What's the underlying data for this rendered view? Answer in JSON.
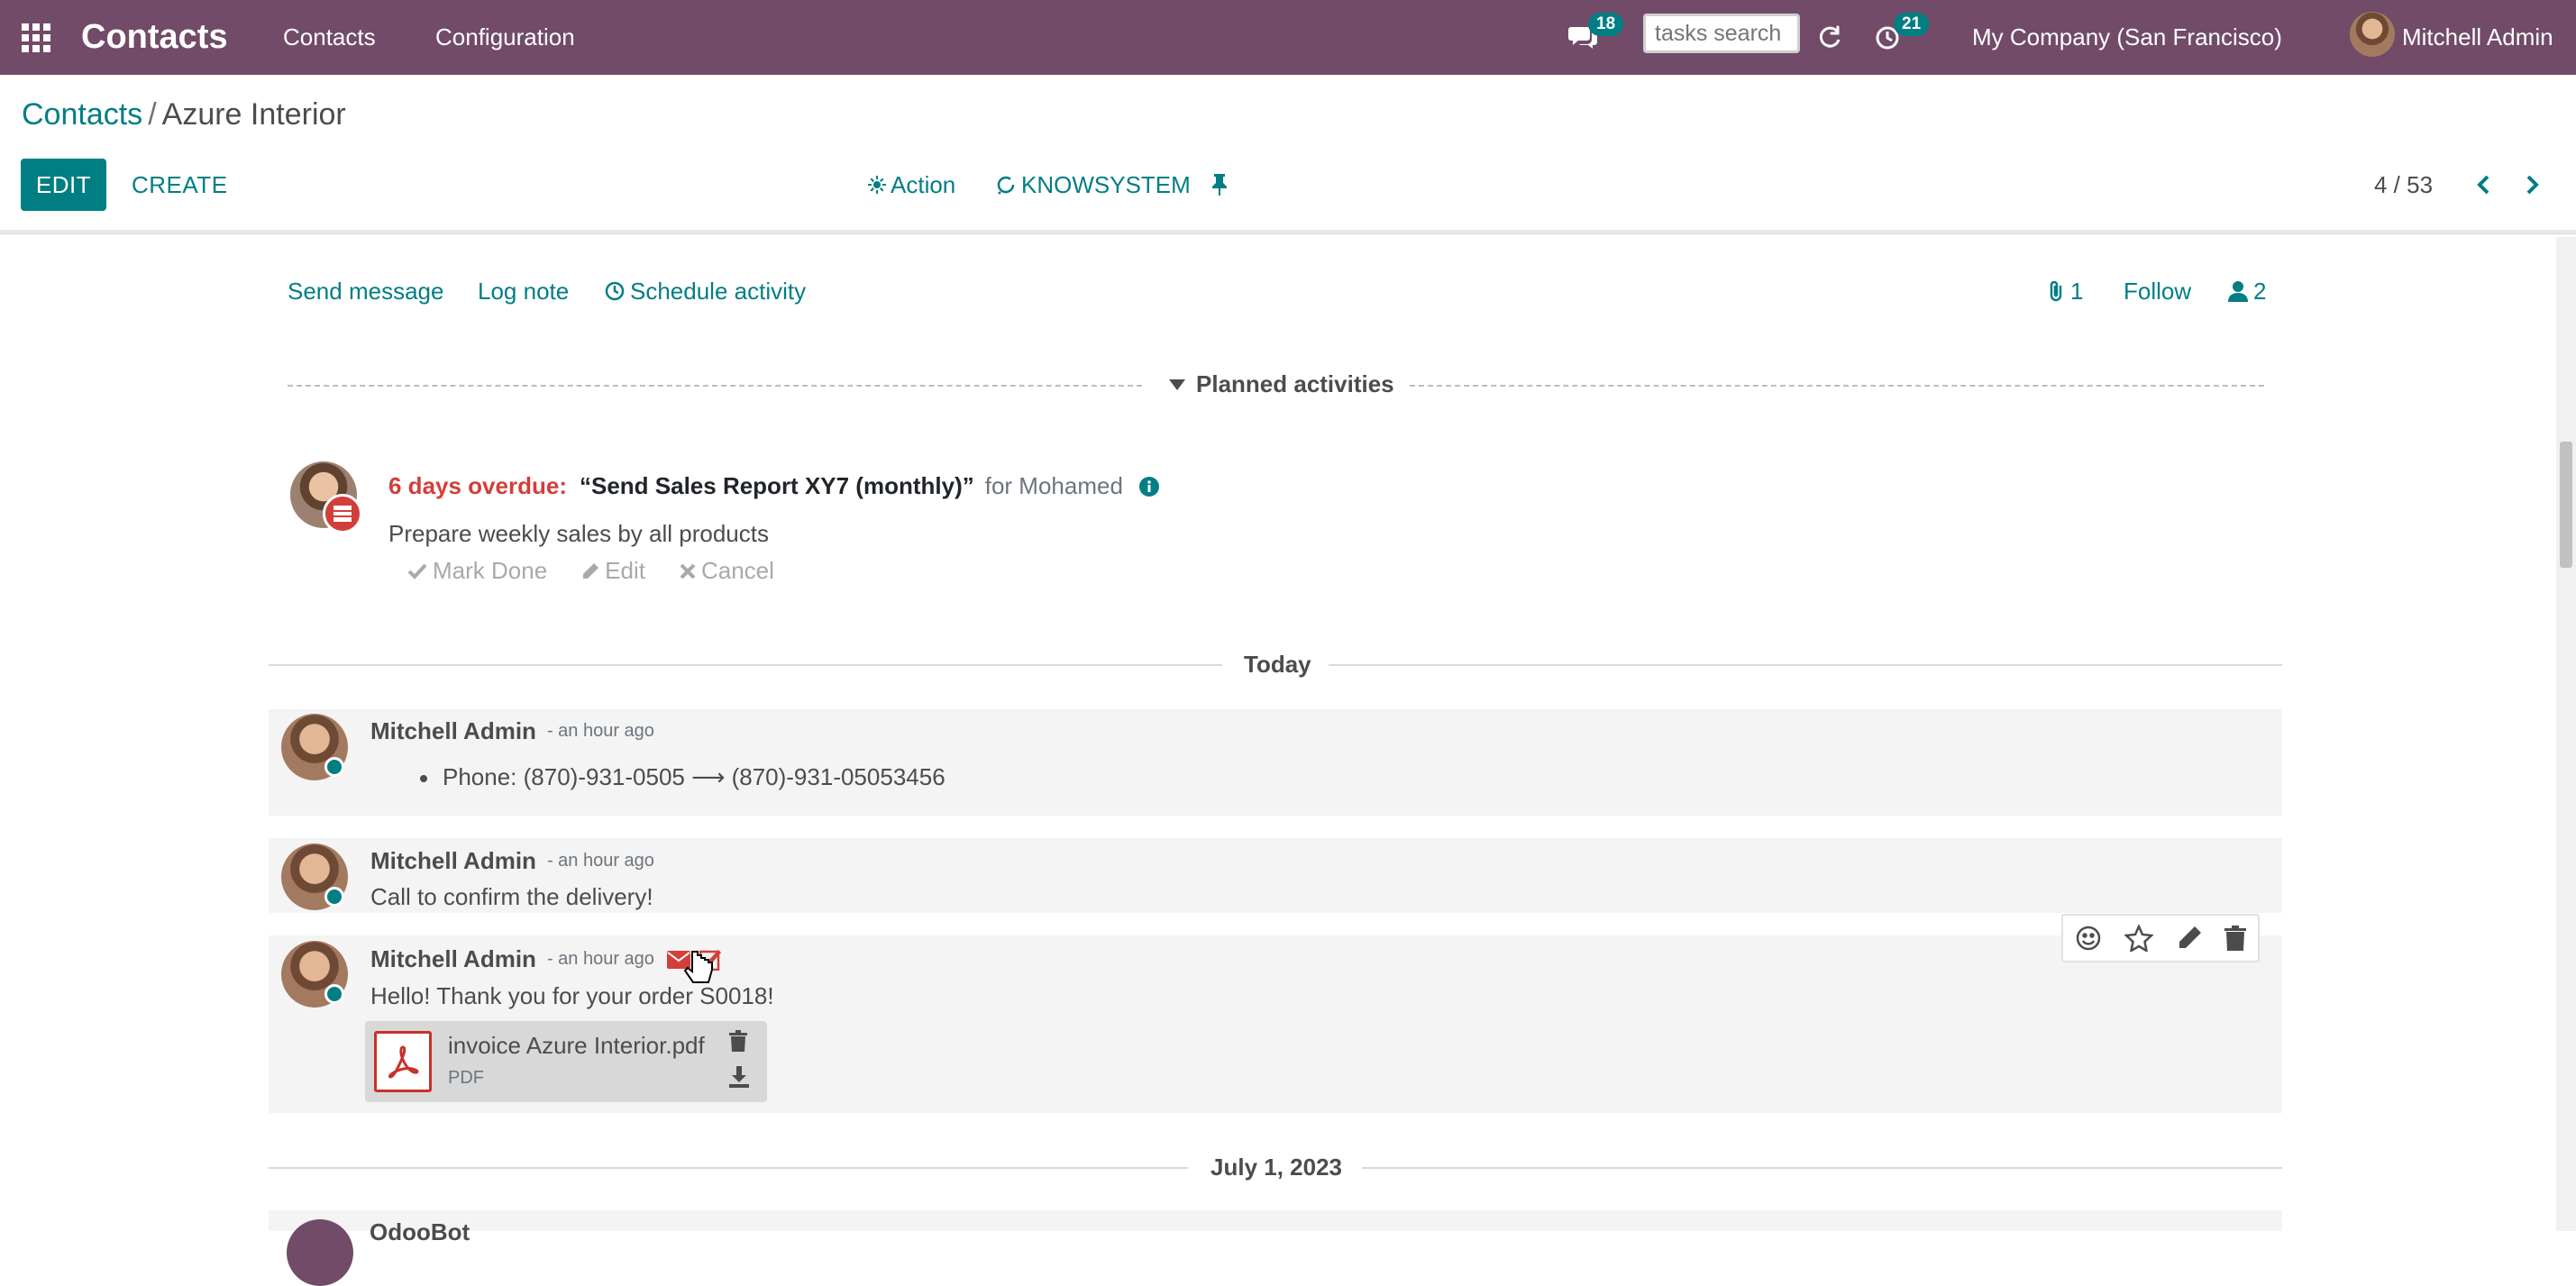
{
  "navbar": {
    "brand": "Contacts",
    "menu": [
      "Contacts",
      "Configuration"
    ],
    "messages_count": "18",
    "search_placeholder": "tasks search",
    "activities_count": "21",
    "company": "My Company (San Francisco)",
    "user": "Mitchell Admin"
  },
  "control_panel": {
    "breadcrumb_root": "Contacts",
    "breadcrumb_separator": "/",
    "breadcrumb_current": "Azure Interior",
    "edit_label": "EDIT",
    "create_label": "CREATE",
    "action_label": "Action",
    "knowsystem_label": "KNOWSYSTEM",
    "pager": "4 / 53"
  },
  "chatter": {
    "send_message": "Send message",
    "log_note": "Log note",
    "schedule_activity": "Schedule activity",
    "attachments_count": "1",
    "follow": "Follow",
    "followers_count": "2"
  },
  "planned_activities": {
    "label": "Planned activities",
    "activity": {
      "overdue": "6 days overdue:",
      "title": "“Send Sales Report XY7 (monthly)”",
      "for": "for Mohamed",
      "description": "Prepare weekly sales by all products",
      "mark_done": "Mark Done",
      "edit": "Edit",
      "cancel": "Cancel"
    }
  },
  "separators": {
    "today": "Today",
    "july": "July 1, 2023"
  },
  "messages": [
    {
      "author": "Mitchell Admin",
      "time": "- an hour ago",
      "tracking": "Phone: (870)-931-0505 ⟶ (870)-931-05053456"
    },
    {
      "author": "Mitchell Admin",
      "time": "- an hour ago",
      "body": "Call to confirm the delivery!"
    },
    {
      "author": "Mitchell Admin",
      "time": "- an hour ago",
      "body": "Hello! Thank you for your order S0018!",
      "attachment": {
        "name": "invoice Azure Interior.pdf",
        "ext": "PDF"
      }
    },
    {
      "author": "OdooBot"
    }
  ],
  "colors": {
    "navbar": "#714b67",
    "primary": "#017e84",
    "danger": "#d23f3a"
  }
}
